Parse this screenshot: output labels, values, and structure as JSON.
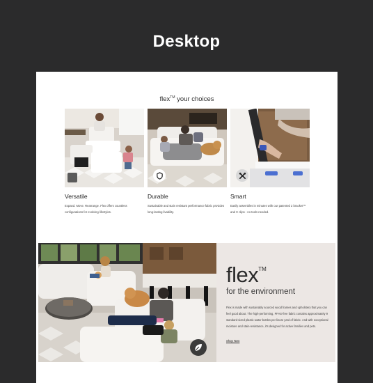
{
  "page": {
    "heading": "Desktop"
  },
  "choices": {
    "title_brand": "flex",
    "title_tm": "TM",
    "title_rest": " your choices",
    "cards": [
      {
        "title": "Versatile",
        "description": "Expand. Move. Rearrange. Flex offers countless configurations for evolving lifestyles."
      },
      {
        "title": "Durable",
        "description": "Sustainable and stain resistant performance fabric provides long-lasting livability."
      },
      {
        "title": "Smart",
        "description": "Easily assembles in minutes with our patented 2 bracket™ and C clips - no tools needed."
      }
    ]
  },
  "environment": {
    "logo": "flex",
    "logo_tm": "TM",
    "subtitle": "for the environment",
    "body": "Flex is made with sustainably sourced wood frames and upholstery that you can feel good about. The high-performing, PFAS-free fabric contains approximately 9 standard-sized plastic water bottles per linear yard of fabric. And with exceptional moisture and stain-resistance, it's designed for active families and pets.",
    "cta": "Shop Now"
  },
  "icons": {
    "durable": "shield-outline-icon",
    "smart": "tools-icon",
    "environment": "leaf-icon"
  },
  "colors": {
    "background": "#2b2b2c",
    "panel": "#ece7e4",
    "sofa": "#f1efec"
  }
}
